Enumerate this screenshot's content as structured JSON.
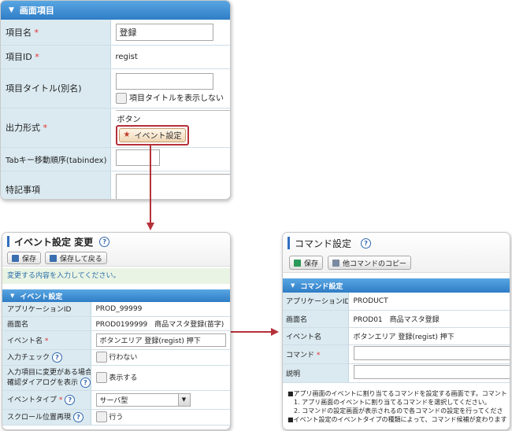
{
  "screen_settings": {
    "section_title": "画面項目",
    "rows": {
      "item_name": {
        "label": "項目名",
        "value": "登録"
      },
      "item_id": {
        "label": "項目ID",
        "value": "regist"
      },
      "item_title": {
        "label": "項目タイトル(別名)",
        "checkbox_label": "項目タイトルを表示しない"
      },
      "output_format": {
        "label": "出力形式",
        "value": "ボタン",
        "event_button": "イベント設定"
      },
      "tab_order": {
        "label": "Tabキー移動順序(tabindex)"
      },
      "notes": {
        "label": "特記事項"
      }
    },
    "required_mark": "*"
  },
  "event_settings": {
    "title": "イベント設定 変更",
    "save_label": "保存",
    "save_back_label": "保存して戻る",
    "message": "変更する内容を入力してください。",
    "section_title": "イベント設定",
    "rows": {
      "app_id": {
        "label": "アプリケーションID",
        "value": "PROD_99999"
      },
      "screen_name": {
        "label": "画面名",
        "value": "PROD0199999　商品マスタ登録(苗字)"
      },
      "event_name": {
        "label": "イベント名",
        "value": "ボタンエリア 登録(regist) 押下"
      },
      "input_check": {
        "label": "入力チェック",
        "checkbox_label": "行わない"
      },
      "confirm_dialog": {
        "label_line1": "入力項目に変更がある場合に",
        "label_line2": "確認ダイアログを表示",
        "checkbox_label": "表示する"
      },
      "event_type": {
        "label": "イベントタイプ",
        "value": "サーバ型"
      },
      "scroll_pos": {
        "label": "スクロール位置再現",
        "checkbox_label": "行う"
      }
    }
  },
  "command_settings": {
    "title": "コマンド設定",
    "save_label": "保存",
    "copy_label": "他コマンドのコピー",
    "section_title": "コマンド設定",
    "rows": {
      "app_id": {
        "label": "アプリケーションID",
        "value": "PRODUCT"
      },
      "screen_name": {
        "label": "画面名",
        "value": "PROD01　商品マスタ登録"
      },
      "event_name": {
        "label": "イベント名",
        "value": "ボタンエリア 登録(regist) 押下"
      },
      "command": {
        "label": "コマンド"
      },
      "description": {
        "label": "説明"
      }
    },
    "notes": [
      "■アプリ画面のイベントに割り当てるコマンドを設定する画面です。コマント",
      "　1. アプリ画面のイベントに割り当てるコマンドを選択してください。",
      "　2. コマンドの設定画面が表示されるので各コマンドの設定を行ってくださ",
      "■イベント設定のイベントタイプの種類によって、コマンド候補が変わります"
    ]
  },
  "colors": {
    "accent_blue": "#2f7dc6",
    "arrow_red": "#b5313a",
    "label_bg": "#dbeaf1"
  }
}
